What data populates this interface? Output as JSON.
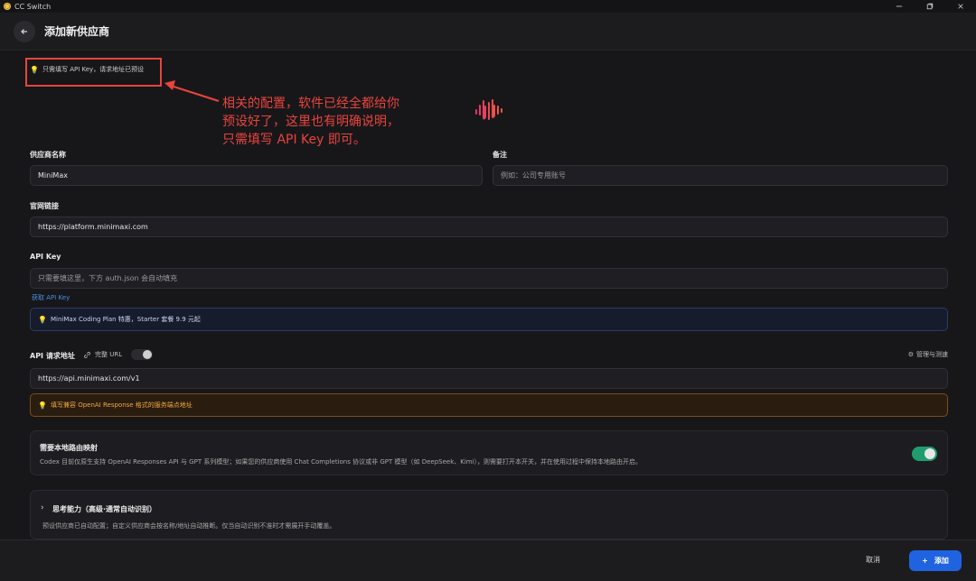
{
  "app": {
    "title": "CC Switch",
    "icon": "app-logo-icon"
  },
  "window_controls": {
    "minimize": "minimize-icon",
    "maximize": "maximize-icon",
    "close": "close-icon"
  },
  "header": {
    "title": "添加新供应商",
    "back_icon": "arrow-left-icon"
  },
  "hint_top": "只需填写 API Key，请求地址已预设",
  "annotation": {
    "color": "#e8443c",
    "line1": "相关的配置，软件已经全都给你",
    "line2": "预设好了，这里也有明确说明，",
    "line3": "只需填写 API Key 即可。"
  },
  "form": {
    "provider_name_label": "供应商名称",
    "provider_name_value": "MiniMax",
    "note_label": "备注",
    "note_placeholder": "例如：公司专用账号",
    "website_label": "官网链接",
    "website_value": "https://platform.minimaxi.com",
    "api_key_label": "API Key",
    "api_key_placeholder": "只需要填这里，下方 auth.json 会自动填充",
    "get_api_key_link": "获取 API Key",
    "promo_text": "MiniMax Coding Plan 特惠，Starter 套餐 9.9 元起",
    "api_url_label": "API 请求地址",
    "full_url_label": "完整 URL",
    "full_url_enabled": false,
    "manage_test_label": "管理与测速",
    "api_url_value": "https://api.minimaxi.com/v1",
    "warn_text": "填写兼容 OpenAI Response 格式的服务端点地址"
  },
  "routing_card": {
    "title": "需要本地路由映射",
    "desc": "Codex 目前仅原生支持 OpenAI Responses API 与 GPT 系列模型；如果您的供应商使用 Chat Completions 协议或非 GPT 模型（如 DeepSeek、Kimi），则需要打开本开关，并在使用过程中保持本地路由开启。",
    "enabled": true
  },
  "thinking_card": {
    "title": "思考能力（高级·通常自动识别）",
    "desc": "预设供应商已自动配置；自定义供应商会按名称/地址自动推断。仅当自动识别不准时才需展开手动覆盖。"
  },
  "footer": {
    "cancel": "取消",
    "add": "添加"
  },
  "colors": {
    "accent": "#1f63e0",
    "toggle_on": "#1f9d6e",
    "warning": "#f0a640",
    "info_border": "#2c3a66"
  }
}
